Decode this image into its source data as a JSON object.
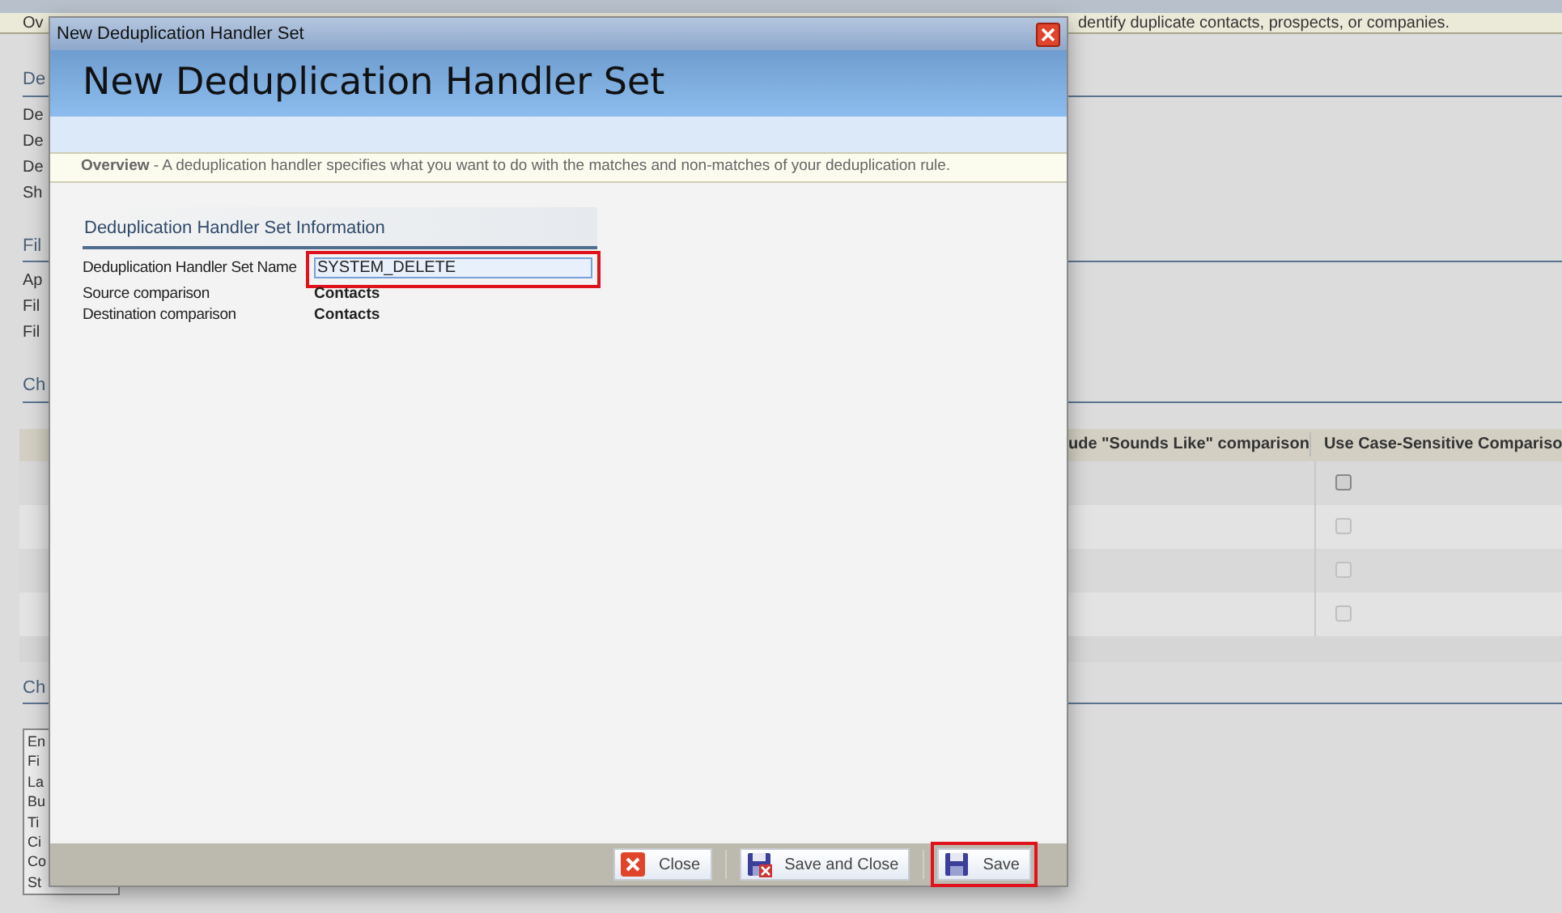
{
  "page": {
    "overview_left": "Ov",
    "overview_right": "dentify duplicate contacts, prospects, or companies.",
    "sections": [
      {
        "heading": "De",
        "rows": [
          "De",
          "De",
          "De",
          "Sh"
        ]
      },
      {
        "heading": "Fil",
        "rows": [
          "Ap",
          "Fil",
          "Fil"
        ]
      },
      {
        "heading": "Ch"
      }
    ],
    "table": {
      "columns": [
        "ude \"Sounds Like\" comparison",
        "Use Case-Sensitive Compariso"
      ],
      "rows": [
        {
          "checked": false,
          "disabled": false
        },
        {
          "checked": false,
          "disabled": true
        },
        {
          "checked": false,
          "disabled": true
        },
        {
          "checked": false,
          "disabled": true
        }
      ]
    },
    "bottom_section": {
      "heading": "Ch",
      "list_items": [
        "En",
        "Fi",
        "La",
        "Bu",
        "Ti",
        "Ci",
        "Co",
        "St"
      ]
    }
  },
  "dialog": {
    "title": "New Deduplication Handler Set",
    "header_title": "New Deduplication Handler Set",
    "overview": "**Overview** - A deduplication handler specifies what you want to do with the matches and non-matches of your deduplication rule.",
    "section_heading": "Deduplication Handler Set Information",
    "fields": [
      {
        "label": "Deduplication Handler Set Name",
        "kind": "input",
        "value": "SYSTEM_DELETE",
        "highlighted": true
      },
      {
        "label": "Source comparison",
        "kind": "text",
        "value": "Contacts",
        "highlighted": false
      },
      {
        "label": "Destination comparison",
        "kind": "text",
        "value": "Contacts",
        "highlighted": false
      }
    ],
    "buttons": [
      {
        "label": "Close",
        "kind": "close",
        "highlighted": false
      },
      {
        "label": "Save and Close",
        "kind": "save_close",
        "highlighted": false
      },
      {
        "label": "Save",
        "kind": "save",
        "highlighted": true
      }
    ]
  }
}
